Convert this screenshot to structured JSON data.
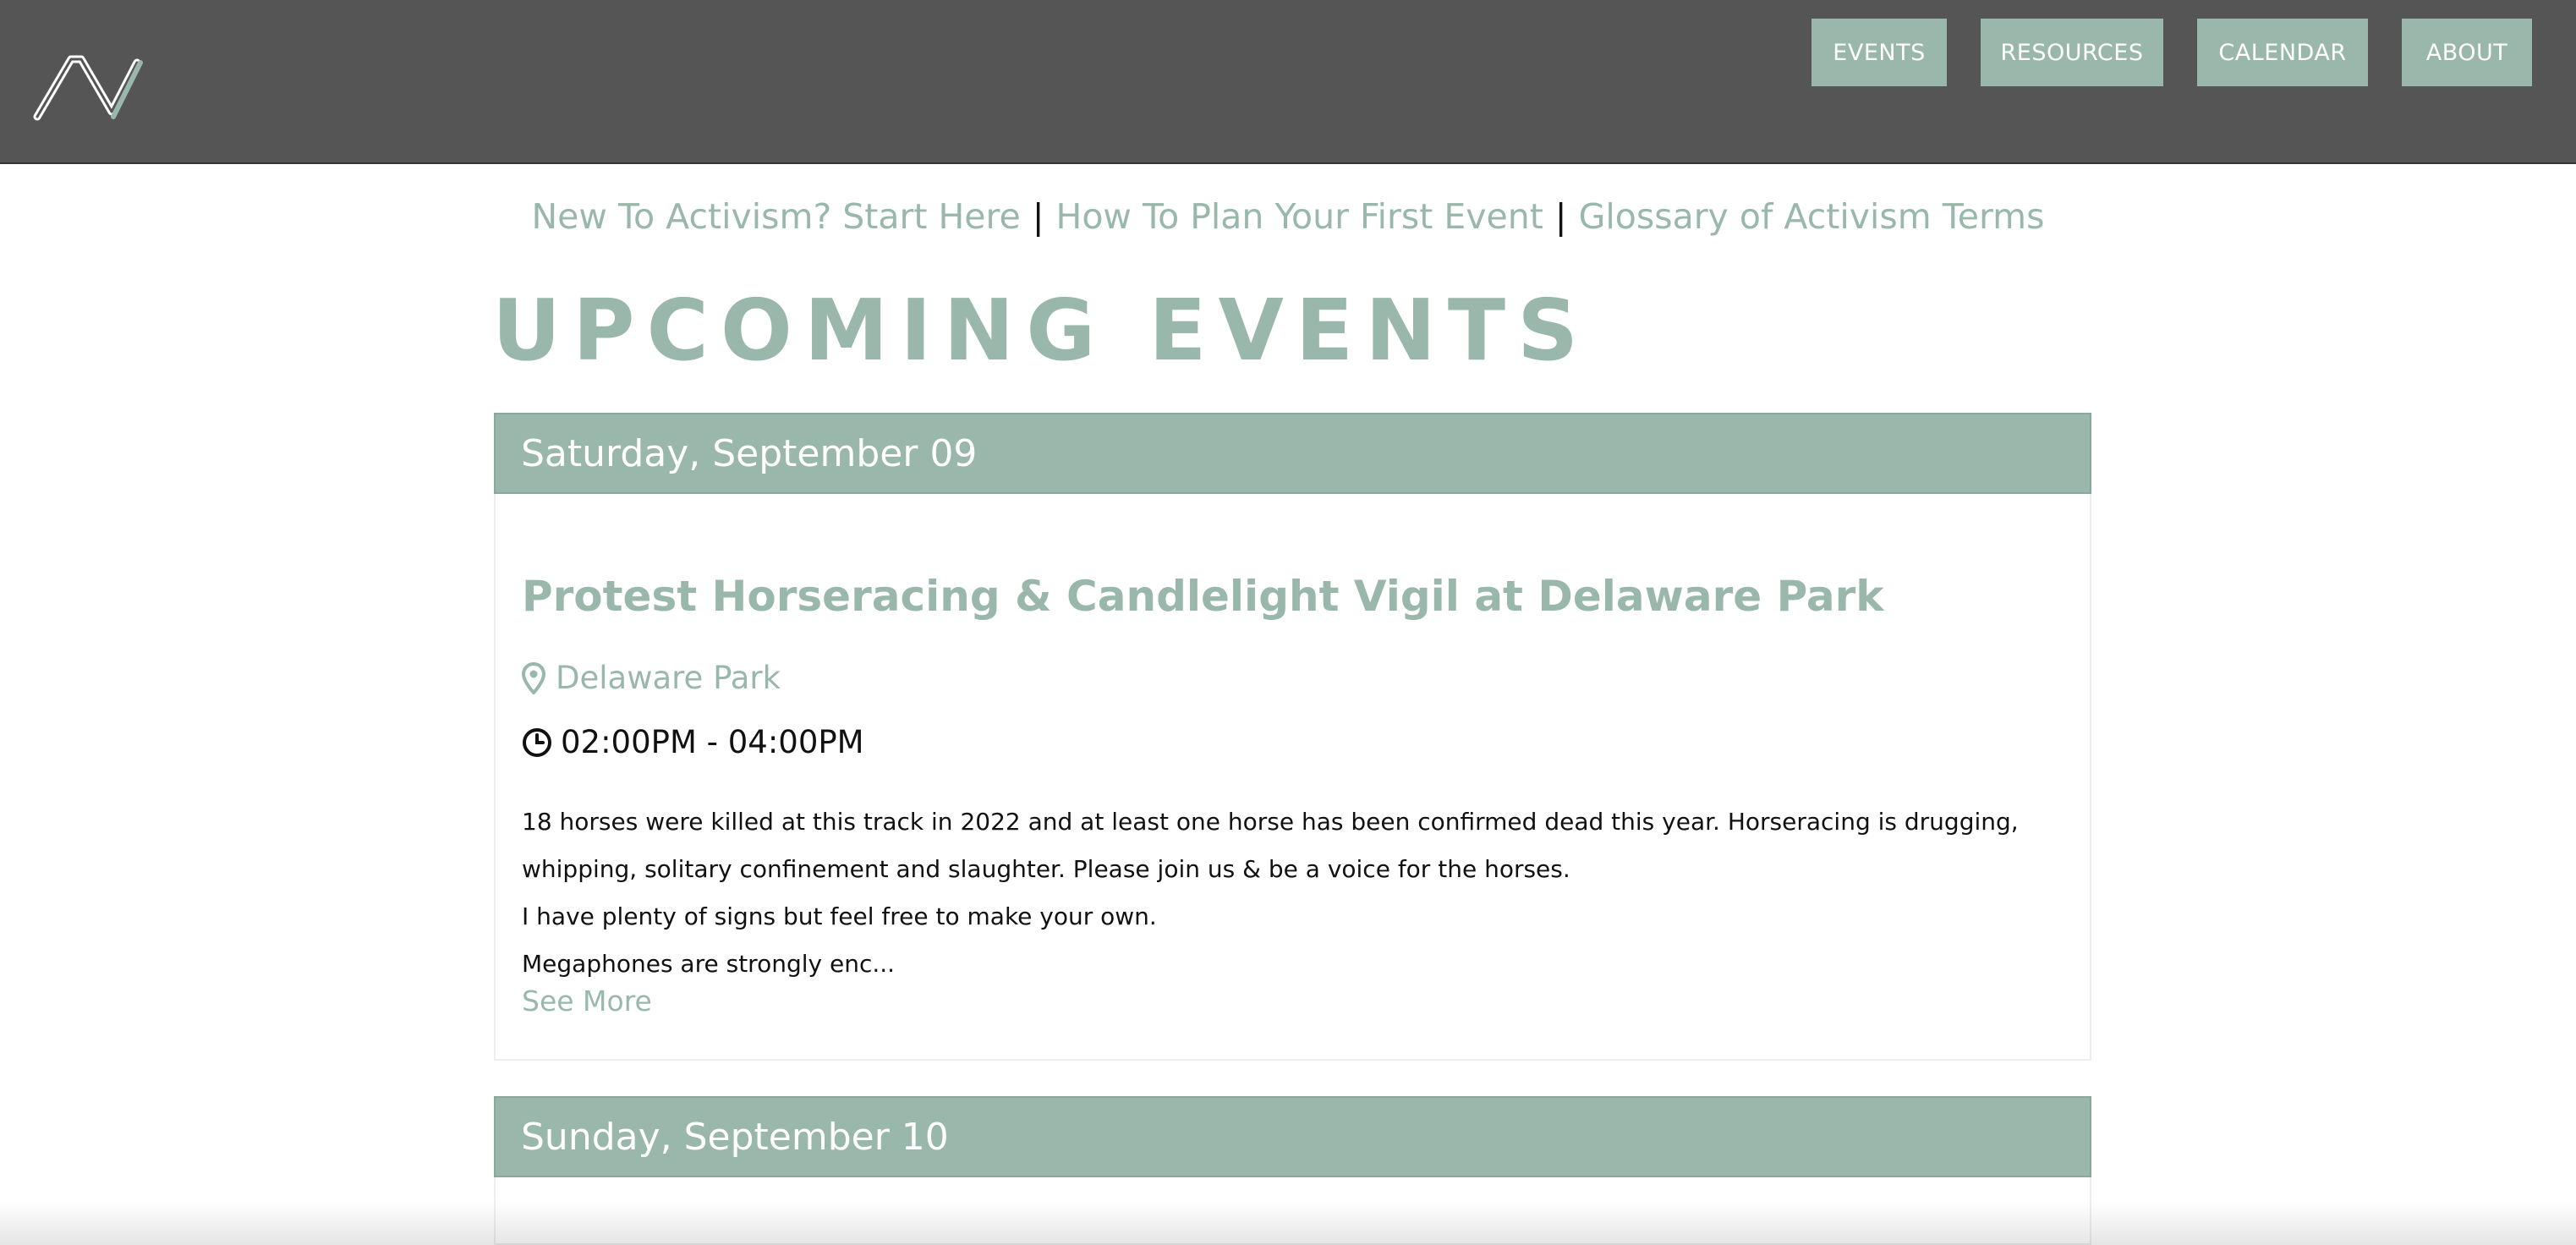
{
  "header": {
    "logo_icon": "zigzag-logo-icon",
    "nav": [
      {
        "label": "EVENTS"
      },
      {
        "label": "RESOURCES"
      },
      {
        "label": "CALENDAR"
      },
      {
        "label": "ABOUT"
      }
    ]
  },
  "sublinks": [
    {
      "label": "New To Activism? Start Here"
    },
    {
      "label": "How To Plan Your First Event"
    },
    {
      "label": "Glossary of Activism Terms"
    }
  ],
  "sublink_separator": "|",
  "page_title": "UPCOMING EVENTS",
  "days": [
    {
      "date": "Saturday, September 09",
      "events": [
        {
          "title": "Protest Horseracing & Candlelight Vigil at Delaware Park",
          "location": "Delaware Park",
          "time": "02:00PM - 04:00PM",
          "description": [
            "18 horses were killed at this track in 2022 and at least one horse has been confirmed dead this year. Horseracing is drugging, whipping, solitary confinement and slaughter. Please join us & be a voice for the horses.",
            "I have plenty of signs but feel free to make your own.",
            "Megaphones are strongly enc..."
          ],
          "see_more": "See More"
        }
      ]
    },
    {
      "date": "Sunday, September 10",
      "events": []
    }
  ],
  "colors": {
    "accent": "#9ab7ab",
    "header_bg": "#555555",
    "text": "#111111"
  }
}
